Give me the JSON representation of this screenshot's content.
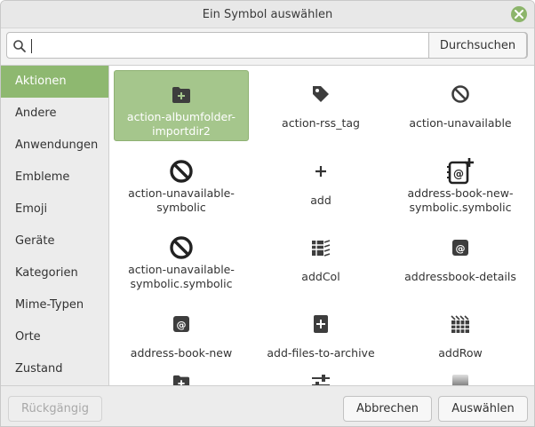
{
  "window": {
    "title": "Ein Symbol auswählen"
  },
  "search": {
    "value": "",
    "placeholder": "",
    "button_label": "Durchsuchen"
  },
  "sidebar": {
    "items": [
      {
        "label": "Aktionen",
        "active": true
      },
      {
        "label": "Andere"
      },
      {
        "label": "Anwendungen"
      },
      {
        "label": "Embleme"
      },
      {
        "label": "Emoji"
      },
      {
        "label": "Geräte"
      },
      {
        "label": "Kategorien"
      },
      {
        "label": "Mime-Typen"
      },
      {
        "label": "Orte"
      },
      {
        "label": "Zustand"
      }
    ]
  },
  "icons": [
    {
      "label_1": "action-albumfolder-",
      "label_2": "importdir2",
      "icon": "folder-plus-icon",
      "selected": true
    },
    {
      "label_1": "action-rss_tag",
      "label_2": "",
      "icon": "tag-icon"
    },
    {
      "label_1": "action-unavailable",
      "label_2": "",
      "icon": "unavailable-icon"
    },
    {
      "label_1": "action-unavailable-",
      "label_2": "symbolic",
      "icon": "unavailable-icon"
    },
    {
      "label_1": "add",
      "label_2": "",
      "icon": "plus-icon"
    },
    {
      "label_1": "address-book-new-",
      "label_2": "symbolic.symbolic",
      "icon": "address-book-new-icon"
    },
    {
      "label_1": "action-unavailable-",
      "label_2": "symbolic.symbolic",
      "icon": "unavailable-icon"
    },
    {
      "label_1": "addCol",
      "label_2": "",
      "icon": "add-column-icon"
    },
    {
      "label_1": "addressbook-details",
      "label_2": "",
      "icon": "addressbook-icon"
    },
    {
      "label_1": "address-book-new",
      "label_2": "",
      "icon": "addressbook-icon"
    },
    {
      "label_1": "add-files-to-archive",
      "label_2": "",
      "icon": "add-file-icon"
    },
    {
      "label_1": "addRow",
      "label_2": "",
      "icon": "add-row-icon"
    }
  ],
  "buttons": {
    "undo": "Rückgängig",
    "cancel": "Abbrechen",
    "select": "Auswählen"
  },
  "colors": {
    "accent": "#8eb870",
    "selected_cell": "#a5c68c",
    "close_button": "#8cb56b",
    "icon": "#3d3d3d"
  }
}
